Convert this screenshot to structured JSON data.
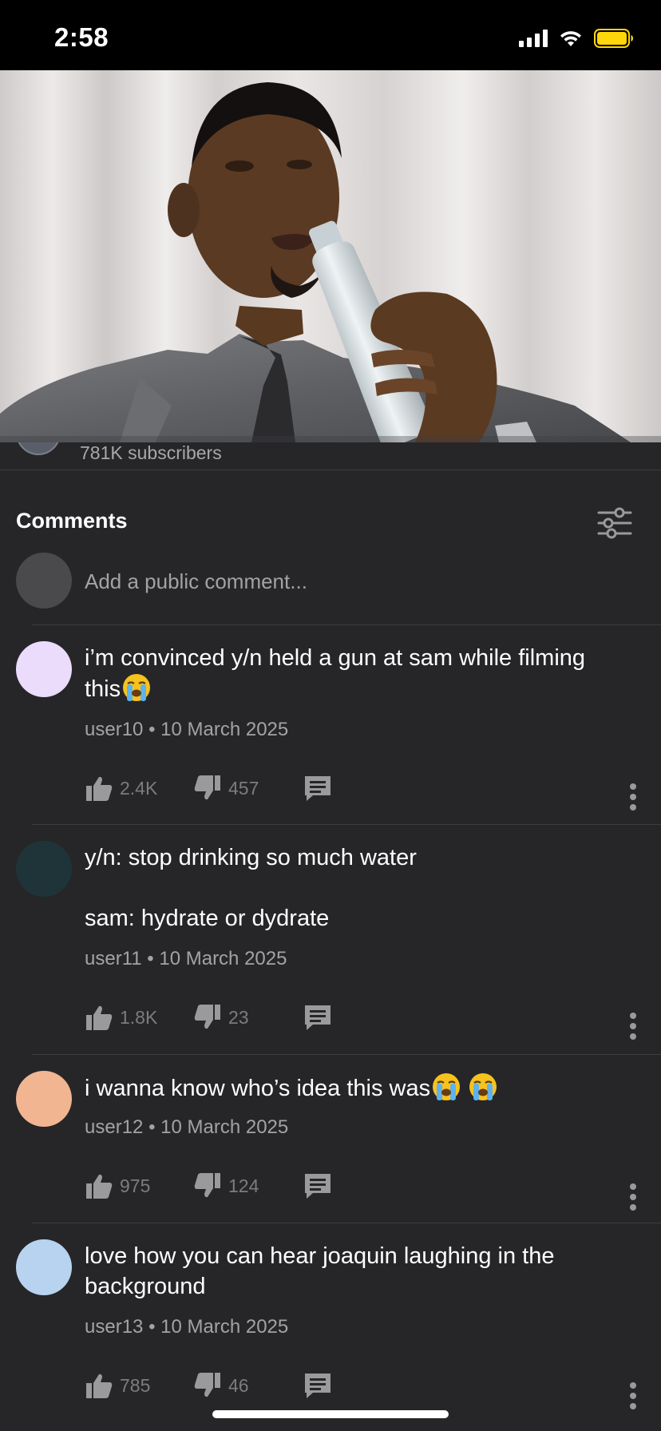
{
  "status_bar": {
    "time": "2:58"
  },
  "channel": {
    "subscribers": "781K subscribers"
  },
  "comments_section": {
    "title": "Comments",
    "add_placeholder": "Add a public comment..."
  },
  "comments": [
    {
      "text": "i’m convinced y/n held a gun at sam while filming this",
      "emojis": [
        "loudly-crying-face"
      ],
      "author": "user10",
      "date": "10 March 2025",
      "likes": "2.4K",
      "dislikes": "457",
      "avatar_color": "#ebdcfb"
    },
    {
      "text": "y/n: stop drinking so much water\n\nsam: hydrate or dydrate",
      "emojis": [],
      "author": "user11",
      "date": "10 March 2025",
      "likes": "1.8K",
      "dislikes": "23",
      "avatar_color": "#1f3438"
    },
    {
      "text": "i wanna know who’s idea this was",
      "emojis": [
        "loudly-crying-face",
        "loudly-crying-face"
      ],
      "author": "user12",
      "date": "10 March 2025",
      "likes": "975",
      "dislikes": "124",
      "avatar_color": "#f2b592"
    },
    {
      "text": "love how you can hear joaquin laughing in the background",
      "emojis": [],
      "author": "user13",
      "date": "10 March 2025",
      "likes": "785",
      "dislikes": "46",
      "avatar_color": "#b7d3f0"
    }
  ],
  "meta_separator": "•"
}
